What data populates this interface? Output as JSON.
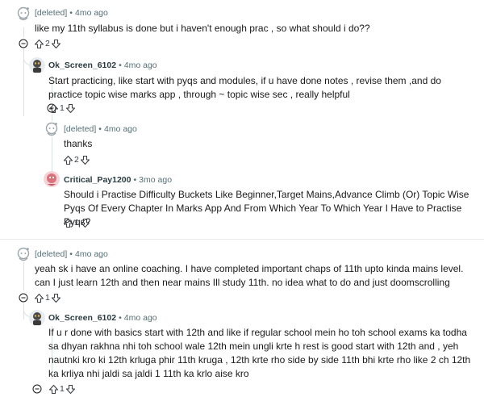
{
  "colors": {
    "thread_line": "#dbe1e3",
    "muted_text": "#576f76",
    "vote_icon": "#3c4043",
    "avatar_grey": "#9aa6ab",
    "avatar_pink": "#d9727a"
  },
  "comments": [
    {
      "user": "[deleted]",
      "time": "4mo ago",
      "body": "like my 11th syllabus is done but i haven't enough prac , so what should i do??",
      "score": "2",
      "avatar": "deleted-avatar"
    },
    {
      "user": "Ok_Screen_6102",
      "time": "4mo ago",
      "body": "Start practicing, like start with pyqs and modules, if u have done notes , revise them ,and do practice topic wise marks app , through ~ topic wise sec , really helpful",
      "score": "1",
      "avatar": "snoo-avatar"
    },
    {
      "user": "[deleted]",
      "time": "4mo ago",
      "body": "thanks",
      "score": "2",
      "avatar": "deleted-avatar"
    },
    {
      "user": "Critical_Pay1200",
      "time": "3mo ago",
      "body": "Should i Practise Difficulty Buckets Like Beginner,Target Mains,Advance Climb (Or) Topic Wise Pyqs Of Every Chapter In Marks App And From Which Year To Which Year I Have to Practise Pyqs?",
      "score": "1",
      "avatar": "pink-avatar"
    },
    {
      "user": "[deleted]",
      "time": "4mo ago",
      "body": "yeah sk i have an online coaching. I have completed important chaps of 11th upto kinda mains level. can I just learn 12th and then near mains Ill study 11th. no idea what to do and just doomscrolling",
      "score": "1",
      "avatar": "deleted-avatar"
    },
    {
      "user": "Ok_Screen_6102",
      "time": "4mo ago",
      "body": "If u r done with basics start with 12th and like if regular school mein ho toh school exams ka todha sa dhyan rakhna nhi toh school wale 12th mein ungli krte h rest is good start with 12th and , yeh nautnki kro ki 12th krluga phir 11th kruga , 12th krte rho side by side 11th bhi krte rho like 2 ch 12th ka krliya nhi jaldi sa jaldi 1 11th ka krlo aise kro",
      "score": "1",
      "avatar": "snoo-avatar"
    }
  ],
  "separator": "•"
}
